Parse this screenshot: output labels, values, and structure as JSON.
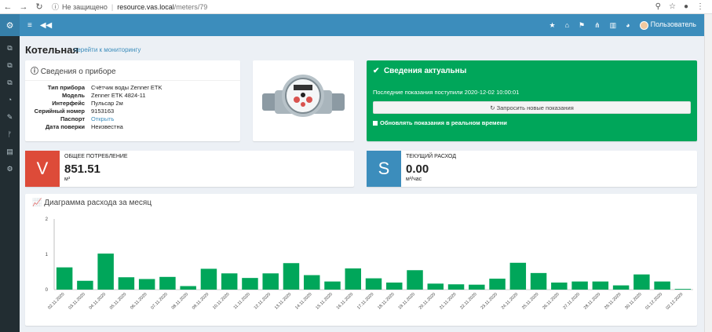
{
  "browser": {
    "security": "Не защищено",
    "host": "resource.vas.local",
    "path": "/meters/79",
    "icons": [
      "back-icon",
      "forward-icon",
      "reload-icon",
      "info-icon",
      "zoom-icon",
      "star-icon",
      "account-icon",
      "menu-icon"
    ]
  },
  "header": {
    "user_label": "Пользователь",
    "icons": [
      "menu-icon",
      "collapse-icon",
      "star-icon",
      "bank-icon",
      "flag-icon",
      "sitemap-icon",
      "chart-icon",
      "dashboard-icon"
    ]
  },
  "sidebar": {
    "items": [
      {
        "icon": "copy-icon",
        "glyph": "⧉"
      },
      {
        "icon": "copy-icon",
        "glyph": "⧉"
      },
      {
        "icon": "copy-icon",
        "glyph": "⧉"
      },
      {
        "icon": "dashboard-icon",
        "glyph": "◔"
      },
      {
        "icon": "edit-icon",
        "glyph": "✎"
      },
      {
        "icon": "branch-icon",
        "glyph": "ᚠ"
      },
      {
        "icon": "book-icon",
        "glyph": "▤"
      },
      {
        "icon": "gear-icon",
        "glyph": "⚙"
      }
    ]
  },
  "page": {
    "title": "Котельная",
    "monitor_link": "перейти к мониторингу"
  },
  "device": {
    "title": "Сведения о приборе",
    "rows": [
      {
        "k": "Тип прибора",
        "v": "Счётчик воды Zenner ETK"
      },
      {
        "k": "Модель",
        "v": "Zenner ETK 4824-11"
      },
      {
        "k": "Интерфейс",
        "v": "Пульсар 2м"
      },
      {
        "k": "Серийный номер",
        "v": "9153163"
      },
      {
        "k": "Паспорт",
        "v": "Открыть"
      },
      {
        "k": "Дата поверки",
        "v": "Неизвестна"
      }
    ]
  },
  "status": {
    "title": "Сведения актуальны",
    "last": "Последние показания поступили 2020-12-02 10:00:01",
    "request": "Запросить новые показания",
    "realtime": "Обновлять показания в реальном времени",
    "color": "#00a65a"
  },
  "total": {
    "letter": "V",
    "label": "ОБЩЕЕ ПОТРЕБЛЕНИЕ",
    "value": "851.51",
    "unit": "м³",
    "color": "#dd4b39"
  },
  "current": {
    "letter": "S",
    "label": "ТЕКУЩИЙ РАСХОД",
    "value": "0.00",
    "unit": "м³/час",
    "color": "#3c8dbc"
  },
  "chart_data": {
    "type": "bar",
    "title": "Диаграмма расхода за месяц",
    "bar_color": "#00a65a",
    "ylim": [
      0,
      2
    ],
    "yticks": [
      "0",
      "1",
      "2"
    ],
    "categories": [
      "02.11.2020",
      "03.11.2020",
      "04.11.2020",
      "05.11.2020",
      "06.11.2020",
      "07.11.2020",
      "08.11.2020",
      "09.11.2020",
      "10.11.2020",
      "11.11.2020",
      "12.11.2020",
      "13.11.2020",
      "14.11.2020",
      "15.11.2020",
      "16.11.2020",
      "17.11.2020",
      "18.11.2020",
      "19.11.2020",
      "20.11.2020",
      "21.11.2020",
      "22.11.2020",
      "23.11.2020",
      "24.11.2020",
      "25.11.2020",
      "26.11.2020",
      "27.11.2020",
      "28.11.2020",
      "29.11.2020",
      "30.11.2020",
      "01.12.2020",
      "02.12.2020"
    ],
    "values": [
      0.63,
      0.25,
      1.02,
      0.35,
      0.3,
      0.36,
      0.1,
      0.59,
      0.46,
      0.33,
      0.46,
      0.75,
      0.41,
      0.23,
      0.6,
      0.32,
      0.2,
      0.55,
      0.17,
      0.15,
      0.14,
      0.31,
      0.76,
      0.47,
      0.2,
      0.23,
      0.23,
      0.12,
      0.43,
      0.23,
      0.02
    ],
    "grid": false
  }
}
